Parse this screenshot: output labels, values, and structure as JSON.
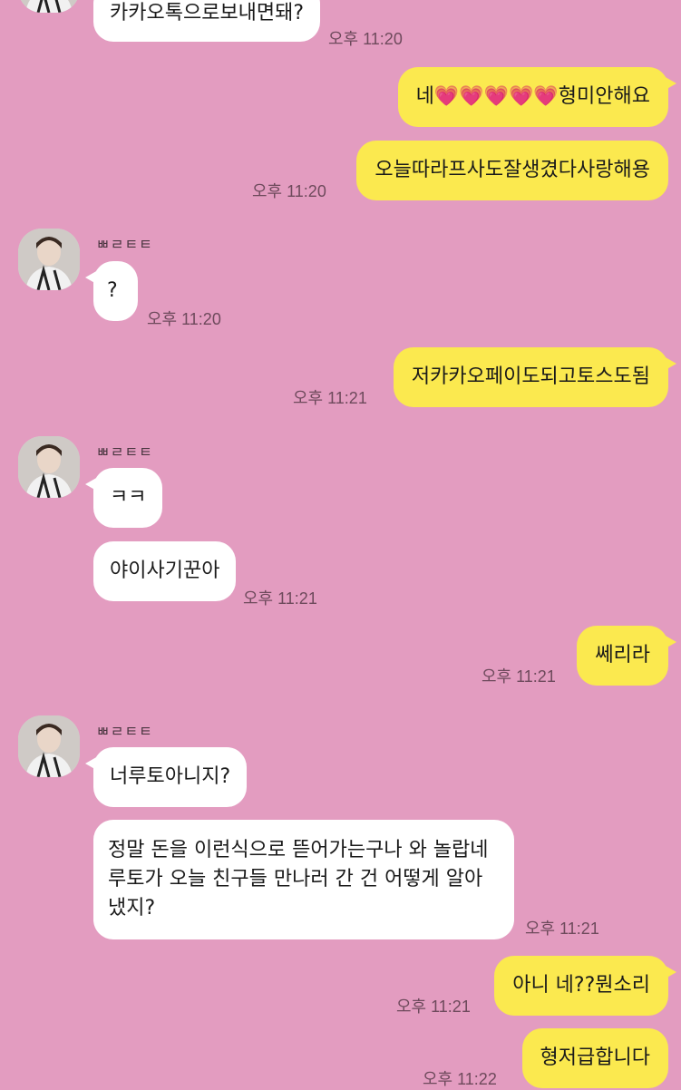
{
  "colors": {
    "background": "#e39cc0",
    "incoming_bubble": "#ffffff",
    "outgoing_bubble": "#fbe94f",
    "timestamp": "#6e4a5c"
  },
  "contact": {
    "name": "ㅃㄹㅌㅌ"
  },
  "messages": [
    {
      "side": "in",
      "text": "카카오톡으로보내면돼?",
      "time": "오후 11:20"
    },
    {
      "side": "out",
      "text_before": "네",
      "hearts": "💗💗💗💗💗",
      "text_after": "형미안해요"
    },
    {
      "side": "out",
      "text": "오늘따라프사도잘생겼다사랑해용",
      "time": "오후 11:20"
    },
    {
      "side": "in",
      "text": "?",
      "time": "오후 11:20"
    },
    {
      "side": "out",
      "text": "저카카오페이도되고토스도됨",
      "time": "오후 11:21"
    },
    {
      "side": "in",
      "text": "ㅋㅋ"
    },
    {
      "side": "in",
      "text": "야이사기꾼아",
      "time": "오후 11:21"
    },
    {
      "side": "out",
      "text": "쎄리라",
      "time": "오후 11:21"
    },
    {
      "side": "in",
      "text": "너루토아니지?"
    },
    {
      "side": "in",
      "text": "정말 돈을 이런식으로 뜯어가는구나 와 놀랍네 루토가 오늘 친구들 만나러 간 건 어떻게 알아냈지?",
      "time": "오후 11:21"
    },
    {
      "side": "out",
      "text": "아니 네??뭔소리",
      "time": "오후 11:21"
    },
    {
      "side": "out",
      "text": "형저급합니다",
      "time": "오후 11:22"
    }
  ]
}
